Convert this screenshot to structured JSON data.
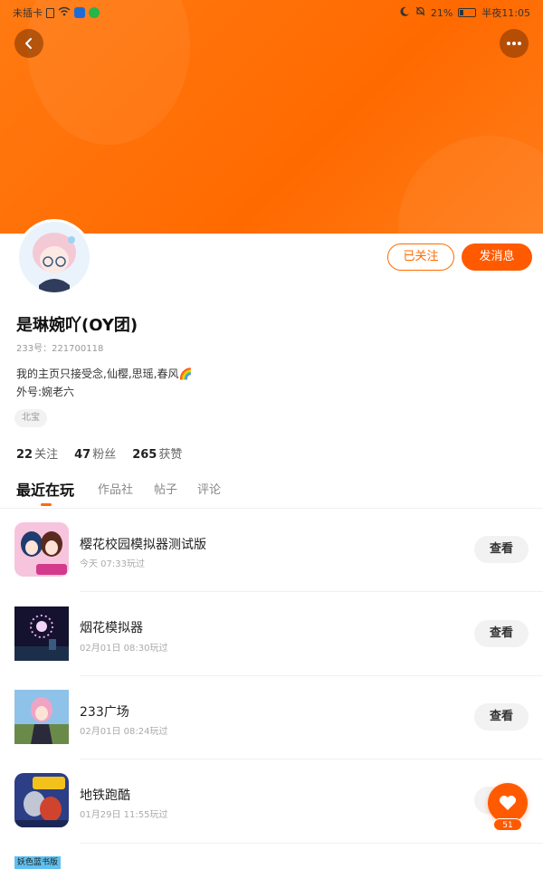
{
  "status_bar": {
    "carrier": "未插卡",
    "battery": "21%",
    "time": "半夜11:05"
  },
  "header": {
    "back_icon": "chevron-left-icon",
    "more_icon": "ellipsis-icon"
  },
  "profile": {
    "name": "是琳婉吖(OY团)",
    "uid": "233号：221700118",
    "bio_line1": "我的主页只接受念,仙樱,思瑶,春风🌈",
    "bio_line2": "外号:婉老六",
    "tag": "北宝",
    "follow_button": "已关注",
    "message_button": "发消息"
  },
  "stats": {
    "following_count": "22",
    "following_label": "关注",
    "fans_count": "47",
    "fans_label": "粉丝",
    "likes_count": "265",
    "likes_label": "获赞"
  },
  "tabs": [
    {
      "label": "最近在玩",
      "active": true
    },
    {
      "label": "作品社",
      "active": false
    },
    {
      "label": "帖子",
      "active": false
    },
    {
      "label": "评论",
      "active": false
    }
  ],
  "games": [
    {
      "name": "樱花校园模拟器测试版",
      "time": "今天 07:33玩过",
      "button": "查看"
    },
    {
      "name": "烟花模拟器",
      "time": "02月01日 08:30玩过",
      "button": "查看"
    },
    {
      "name": "233广场",
      "time": "02月01日 08:24玩过",
      "button": "查看"
    },
    {
      "name": "地铁跑酷",
      "time": "01月29日 11:55玩过",
      "button": "查看"
    }
  ],
  "partial_item_text": "妖色蓝书版",
  "fab": {
    "icon": "heart-icon",
    "count": "51"
  },
  "colors": {
    "accent": "#ff5a00",
    "hero": "#ff6a00"
  }
}
